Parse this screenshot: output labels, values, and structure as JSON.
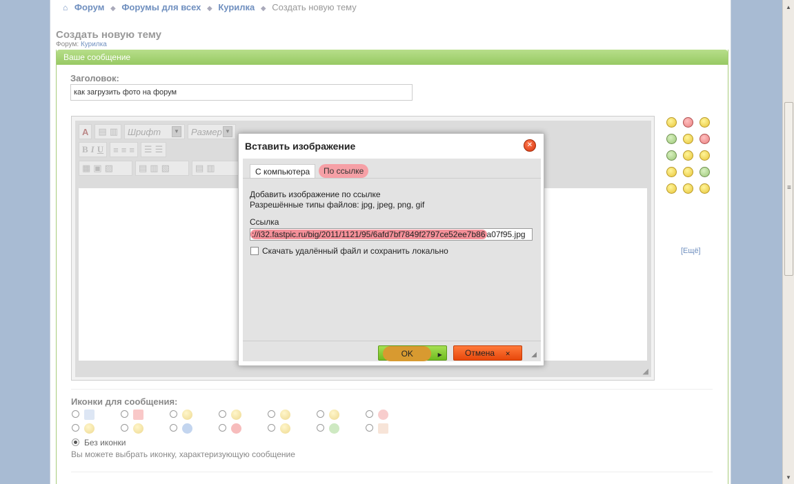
{
  "breadcrumb": {
    "items": [
      "Форум",
      "Форумы для всех",
      "Курилка"
    ],
    "current": "Создать новую тему"
  },
  "page": {
    "title": "Создать новую тему",
    "forum_label": "Форум:",
    "forum_link": "Курилка"
  },
  "panel": {
    "header": "Ваше сообщение",
    "subject_label": "Заголовок:",
    "subject_value": "как загрузить фото на форум"
  },
  "editor": {
    "font_placeholder": "Шрифт",
    "size_placeholder": "Размер",
    "bold": "B",
    "italic": "I",
    "underline": "U",
    "more_smileys": "[Ещё]"
  },
  "icons_section": {
    "label": "Иконки для сообщения:",
    "no_icon": "Без иконки",
    "hint": "Вы можете выбрать иконку, характеризующую сообщение"
  },
  "dialog": {
    "title": "Вставить изображение",
    "tab_computer": "С компьютера",
    "tab_link": "По ссылке",
    "line1": "Добавить изображение по ссылке",
    "line2": "Разрешённые типы файлов: jpg, jpeg, png, gif",
    "link_label": "Ссылка",
    "url_highlight": "://i32.fastpic.ru/big/2011/1121/95/6afd7bf7849f2797ce52ee7b86",
    "url_rest": "a07f95.jpg",
    "checkbox_label": "Скачать удалённый файл и сохранить локально",
    "ok": "OK",
    "cancel": "Отмена"
  }
}
